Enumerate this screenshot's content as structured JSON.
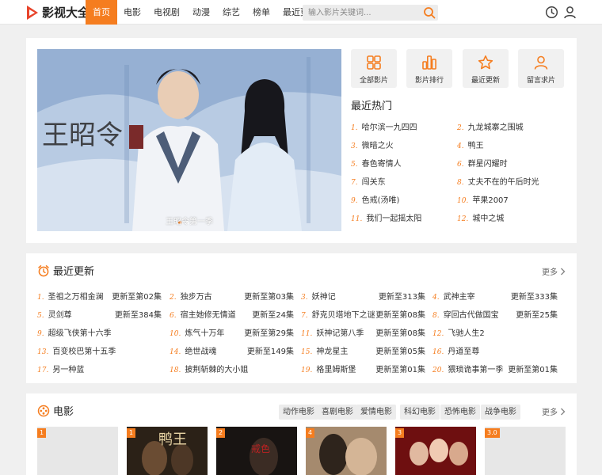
{
  "header": {
    "logo_text": "影视大全",
    "nav": [
      "首页",
      "电影",
      "电视剧",
      "动漫",
      "综艺",
      "榜单",
      "最近更新"
    ],
    "search_placeholder": "输入影片关键词...",
    "accent": "#f57d1f"
  },
  "hero": {
    "banner_caption": "王昭令第一季",
    "quick_links": [
      {
        "label": "全部影片",
        "icon": "grid-icon"
      },
      {
        "label": "影片排行",
        "icon": "bar-chart-icon"
      },
      {
        "label": "最近更新",
        "icon": "star-icon"
      },
      {
        "label": "留言求片",
        "icon": "user-icon"
      }
    ],
    "hot_title": "最近热门",
    "hot": [
      {
        "num": "1.",
        "title": "哈尔滨一九四四"
      },
      {
        "num": "2.",
        "title": "九龙城寨之围城"
      },
      {
        "num": "3.",
        "title": "微暗之火"
      },
      {
        "num": "4.",
        "title": "鸭王"
      },
      {
        "num": "5.",
        "title": "春色寄情人"
      },
      {
        "num": "6.",
        "title": "群星闪耀时"
      },
      {
        "num": "7.",
        "title": "闯关东"
      },
      {
        "num": "8.",
        "title": "丈夫不在的午后时光"
      },
      {
        "num": "9.",
        "title": "色戒(汤唯)"
      },
      {
        "num": "10.",
        "title": "苹果2007"
      },
      {
        "num": "11.",
        "title": "我们一起摇太阳"
      },
      {
        "num": "12.",
        "title": "城中之城"
      }
    ]
  },
  "recent": {
    "title": "最近更新",
    "more": "更多",
    "items": [
      {
        "num": "1.",
        "title": "圣祖之万相金澜",
        "ep": "更新至第02集"
      },
      {
        "num": "2.",
        "title": "独步万古",
        "ep": "更新至第03集"
      },
      {
        "num": "3.",
        "title": "妖神记",
        "ep": "更新至313集"
      },
      {
        "num": "4.",
        "title": "武神主宰",
        "ep": "更新至333集"
      },
      {
        "num": "5.",
        "title": "灵剑尊",
        "ep": "更新至384集"
      },
      {
        "num": "6.",
        "title": "宿主她修无情道",
        "ep": "更新至24集"
      },
      {
        "num": "7.",
        "title": "舒克贝塔地下之谜",
        "ep": "更新至第08集"
      },
      {
        "num": "8.",
        "title": "穿回古代做国宝",
        "ep": "更新至25集"
      },
      {
        "num": "9.",
        "title": "超级飞侠第十六季",
        "ep": ""
      },
      {
        "num": "10.",
        "title": "炼气十万年",
        "ep": "更新至第29集"
      },
      {
        "num": "11.",
        "title": "妖神记第八季",
        "ep": "更新至第08集"
      },
      {
        "num": "12.",
        "title": "飞驰人生2",
        "ep": ""
      },
      {
        "num": "13.",
        "title": "百变校巴第十五季",
        "ep": ""
      },
      {
        "num": "14.",
        "title": "绝世战魂",
        "ep": "更新至149集"
      },
      {
        "num": "15.",
        "title": "神龙星主",
        "ep": "更新至第05集"
      },
      {
        "num": "16.",
        "title": "丹道至尊",
        "ep": ""
      },
      {
        "num": "17.",
        "title": "另一种蓝",
        "ep": ""
      },
      {
        "num": "18.",
        "title": "披荆斩棘的大小姐",
        "ep": ""
      },
      {
        "num": "19.",
        "title": "格里姆斯堡",
        "ep": "更新至第01集"
      },
      {
        "num": "20.",
        "title": "猥琐诡事第一季",
        "ep": "更新至第01集"
      }
    ]
  },
  "movies": {
    "title": "电影",
    "more": "更多",
    "tags": [
      "动作电影",
      "喜剧电影",
      "爱情电影",
      "科幻电影",
      "恐怖电影",
      "战争电影"
    ],
    "posters": [
      {
        "badge": "1",
        "title": "鸭王"
      },
      {
        "badge": "1",
        "title": ""
      },
      {
        "badge": "2",
        "title": "戒色"
      },
      {
        "badge": "4",
        "title": ""
      },
      {
        "badge": "3",
        "title": ""
      },
      {
        "badge": "3.0",
        "title": ""
      }
    ]
  }
}
